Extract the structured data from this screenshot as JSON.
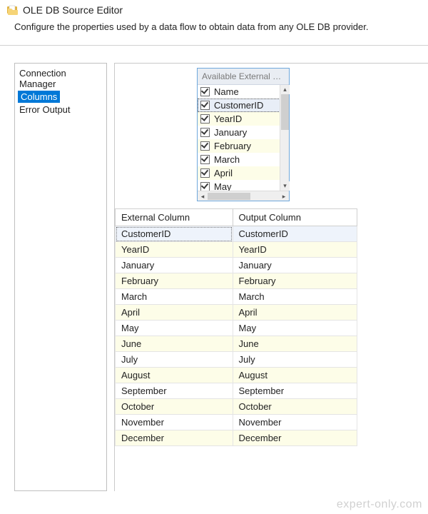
{
  "window": {
    "title": "OLE DB Source Editor",
    "description": "Configure the properties used by a data flow to obtain data from any OLE DB provider."
  },
  "nav": {
    "items": [
      "Connection Manager",
      "Columns",
      "Error Output"
    ],
    "selected_index": 1
  },
  "available_box": {
    "header": "Available External C...",
    "items": [
      {
        "label": "Name",
        "checked": true,
        "alt": false
      },
      {
        "label": "CustomerID",
        "checked": true,
        "alt": false,
        "selected": true
      },
      {
        "label": "YearID",
        "checked": true,
        "alt": true
      },
      {
        "label": "January",
        "checked": true,
        "alt": false
      },
      {
        "label": "February",
        "checked": true,
        "alt": true
      },
      {
        "label": "March",
        "checked": true,
        "alt": false
      },
      {
        "label": "April",
        "checked": true,
        "alt": true
      },
      {
        "label": "May",
        "checked": true,
        "alt": false
      }
    ]
  },
  "mapping": {
    "headers": {
      "external": "External Column",
      "output": "Output Column"
    },
    "rows": [
      {
        "external": "CustomerID",
        "output": "CustomerID",
        "alt": false,
        "selected": true
      },
      {
        "external": "YearID",
        "output": "YearID",
        "alt": true
      },
      {
        "external": "January",
        "output": "January",
        "alt": false
      },
      {
        "external": "February",
        "output": "February",
        "alt": true
      },
      {
        "external": "March",
        "output": "March",
        "alt": false
      },
      {
        "external": "April",
        "output": "April",
        "alt": true
      },
      {
        "external": "May",
        "output": "May",
        "alt": false
      },
      {
        "external": "June",
        "output": "June",
        "alt": true
      },
      {
        "external": "July",
        "output": "July",
        "alt": false
      },
      {
        "external": "August",
        "output": "August",
        "alt": true
      },
      {
        "external": "September",
        "output": "September",
        "alt": false
      },
      {
        "external": "October",
        "output": "October",
        "alt": true
      },
      {
        "external": "November",
        "output": "November",
        "alt": false
      },
      {
        "external": "December",
        "output": "December",
        "alt": true
      }
    ]
  },
  "watermark": "expert-only.com"
}
